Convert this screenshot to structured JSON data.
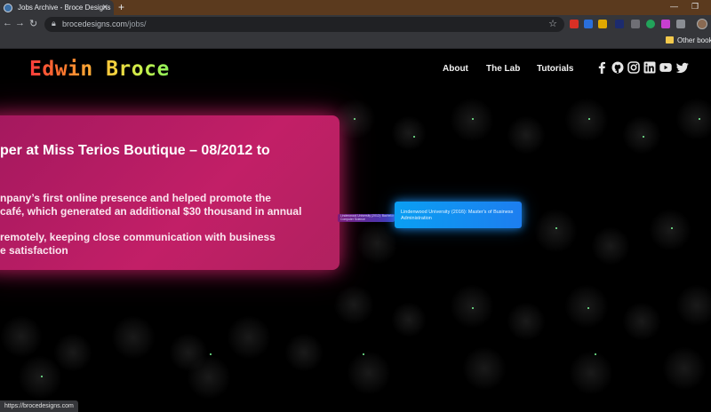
{
  "browser": {
    "tab_title": "Jobs Archive - Broce Designs",
    "url_domain": "brocedesigns.com",
    "url_path": "/jobs/",
    "bookmarks_other": "Other bookm",
    "status_url": "https://brocedesigns.com"
  },
  "site": {
    "logo": "Edwin Broce",
    "nav": [
      "About",
      "The Lab",
      "Tutorials"
    ],
    "social_icons": [
      "facebook-icon",
      "github-icon",
      "instagram-icon",
      "linkedin-icon",
      "youtube-icon",
      "twitter-icon"
    ]
  },
  "job_card": {
    "heading": "per at Miss Terios Boutique – 08/2012 to",
    "para1_line1": "npany’s first online presence and helped promote the",
    "para1_line2": "café, which generated an additional $30 thousand in annual",
    "para2_line1": "remotely, keeping close communication with business",
    "para2_line2": "e satisfaction"
  },
  "timeline": {
    "connector_line1": "Lindenwood University (2012): Bachelor's of Science,",
    "connector_line2": "Computer Science",
    "education_line1": "Lindenwood University (2016): Master's of Business",
    "education_line2": "Administration"
  },
  "colors": {
    "card": "#c21f67",
    "education": "#0a9ff2",
    "page_bg": "#000000"
  }
}
